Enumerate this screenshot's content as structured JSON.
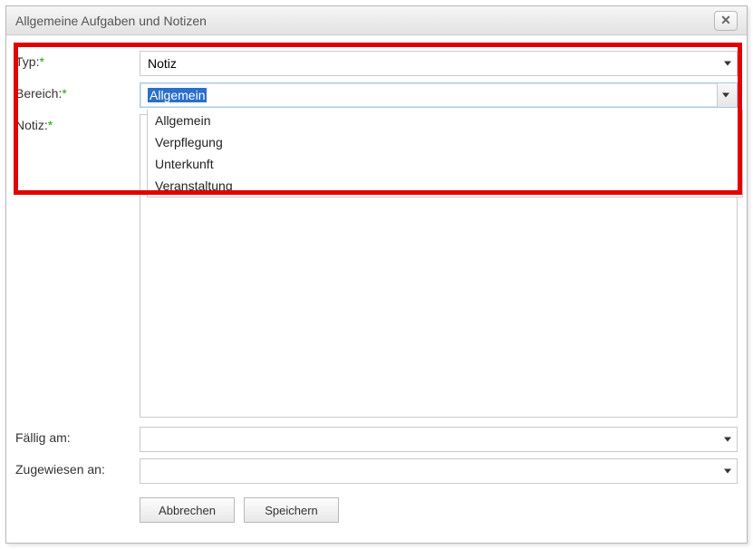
{
  "dialog": {
    "title": "Allgemeine Aufgaben und Notizen"
  },
  "fields": {
    "typ": {
      "label": "Typ:",
      "value": "Notiz"
    },
    "bereich": {
      "label": "Bereich:",
      "value": "Allgemein",
      "options": [
        "Allgemein",
        "Verpflegung",
        "Unterkunft",
        "Veranstaltung"
      ]
    },
    "notiz": {
      "label": "Notiz:",
      "value": ""
    },
    "faellig": {
      "label": "Fällig am:",
      "value": ""
    },
    "zugewiesen": {
      "label": "Zugewiesen an:",
      "value": ""
    }
  },
  "buttons": {
    "cancel": "Abbrechen",
    "save": "Speichern"
  }
}
